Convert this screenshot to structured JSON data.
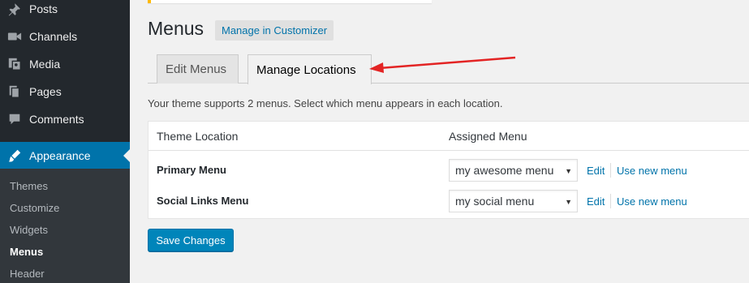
{
  "sidebar": {
    "items": [
      {
        "label": "Posts",
        "icon": "pushpin-icon"
      },
      {
        "label": "Channels",
        "icon": "video-icon"
      },
      {
        "label": "Media",
        "icon": "media-icon"
      },
      {
        "label": "Pages",
        "icon": "pages-icon"
      },
      {
        "label": "Comments",
        "icon": "comment-icon"
      },
      {
        "label": "Appearance",
        "icon": "paintbrush-icon"
      }
    ],
    "submenu": [
      "Themes",
      "Customize",
      "Widgets",
      "Menus",
      "Header"
    ]
  },
  "header": {
    "title": "Menus",
    "customizer_label": "Manage in Customizer"
  },
  "tabs": [
    {
      "label": "Edit Menus"
    },
    {
      "label": "Manage Locations"
    }
  ],
  "description": "Your theme supports 2 menus. Select which menu appears in each location.",
  "table": {
    "col_location": "Theme Location",
    "col_assigned": "Assigned Menu",
    "rows": [
      {
        "location": "Primary Menu",
        "selected": "my awesome menu",
        "edit": "Edit",
        "use_new": "Use new menu"
      },
      {
        "location": "Social Links Menu",
        "selected": "my social menu",
        "edit": "Edit",
        "use_new": "Use new menu"
      }
    ]
  },
  "save_label": "Save Changes",
  "colors": {
    "sidebar_bg": "#23282d",
    "active_bg": "#0073aa",
    "link": "#0073aa",
    "primary_button": "#0085ba",
    "annotation_arrow": "#e32424"
  }
}
